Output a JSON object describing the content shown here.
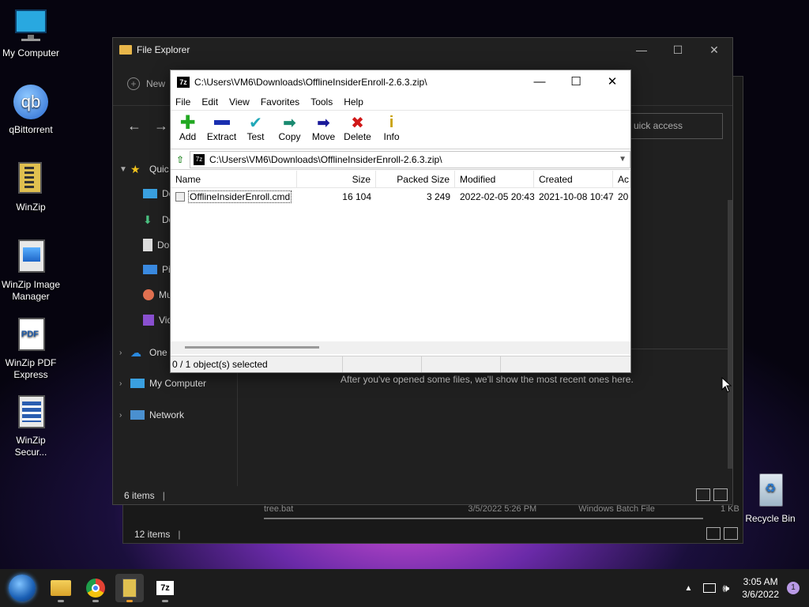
{
  "desktop": {
    "icons": [
      {
        "label": "My Computer"
      },
      {
        "label": "qBittorrent"
      },
      {
        "label": "WinZip"
      },
      {
        "label": "WinZip Image Manager"
      },
      {
        "label": "WinZip PDF Express"
      },
      {
        "label": "WinZip Secur..."
      },
      {
        "label": "Recycle Bin"
      }
    ]
  },
  "back_explorer": {
    "row_text": "tree.bat",
    "row_date": "3/5/2022 5:26 PM",
    "row_type": "Windows Batch File",
    "row_size": "1 KB",
    "status": "12 items"
  },
  "explorer": {
    "title": "File Explorer",
    "new_label": "New",
    "search_placeholder": "uick access",
    "sidebar": {
      "quick_access": "Quic",
      "desktop": "De",
      "downloads": "Do",
      "documents": "Do",
      "pictures": "Pic",
      "music": "Mu",
      "videos": "Vid",
      "onedrive": "One",
      "my_computer": "My Computer",
      "network": "Network"
    },
    "empty_message": "After you've opened some files, we'll show the most recent ones here.",
    "status": "6 items"
  },
  "zip": {
    "app_icon": "7z",
    "title": "C:\\Users\\VM6\\Downloads\\OfflineInsiderEnroll-2.6.3.zip\\",
    "menu": [
      "File",
      "Edit",
      "View",
      "Favorites",
      "Tools",
      "Help"
    ],
    "toolbar": [
      "Add",
      "Extract",
      "Test",
      "Copy",
      "Move",
      "Delete",
      "Info"
    ],
    "path": "C:\\Users\\VM6\\Downloads\\OfflineInsiderEnroll-2.6.3.zip\\",
    "columns": [
      "Name",
      "Size",
      "Packed Size",
      "Modified",
      "Created",
      "Ac"
    ],
    "files": [
      {
        "name": "OfflineInsiderEnroll.cmd",
        "size": "16 104",
        "packed": "3 249",
        "modified": "2022-02-05 20:43",
        "created": "2021-10-08 10:47",
        "accessed": "20"
      }
    ],
    "status": "0 / 1 object(s) selected"
  },
  "taskbar": {
    "time": "3:05 AM",
    "date": "3/6/2022",
    "notification_count": "1",
    "app_7z": "7z"
  }
}
